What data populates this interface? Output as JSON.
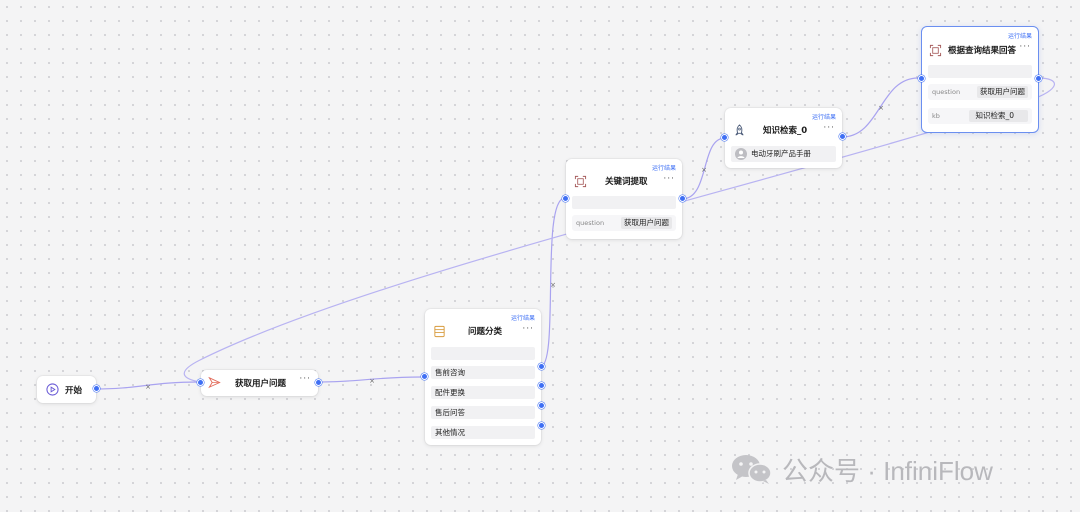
{
  "canvas": {
    "edge_labels": [
      "×",
      "×",
      "×",
      "×",
      "×"
    ]
  },
  "nodes": {
    "start": {
      "title": "开始",
      "icon": "play-circle-icon"
    },
    "get_question": {
      "title": "获取用户问题",
      "icon": "paper-plane-icon",
      "more": "···"
    },
    "classify": {
      "title": "问题分类",
      "icon": "list-icon",
      "run_result": "运行结果",
      "more": "···",
      "categories": [
        "售前咨询",
        "配件更换",
        "售后问答",
        "其他情况"
      ]
    },
    "keyword": {
      "title": "关键词提取",
      "icon": "frame-icon",
      "run_result": "运行结果",
      "more": "···",
      "params": [
        {
          "key": "question",
          "value": "获取用户问题"
        }
      ]
    },
    "retrieval": {
      "title": "知识检索_0",
      "icon": "rocket-icon",
      "run_result": "运行结果",
      "more": "···",
      "kb_name": "电动牙刷产品手册"
    },
    "answer": {
      "title": "根据查询结果回答",
      "icon": "frame-icon",
      "run_result": "运行结果",
      "more": "···",
      "params": [
        {
          "key": "question",
          "value": "获取用户问题"
        },
        {
          "key": "kb",
          "value": "知识检索_0"
        }
      ]
    }
  },
  "colors": {
    "accent": "#3f6ff4",
    "edge": "#a9a3f0"
  },
  "watermark": {
    "text": "公众号 · InfiniFlow",
    "icon": "wechat-icon"
  }
}
